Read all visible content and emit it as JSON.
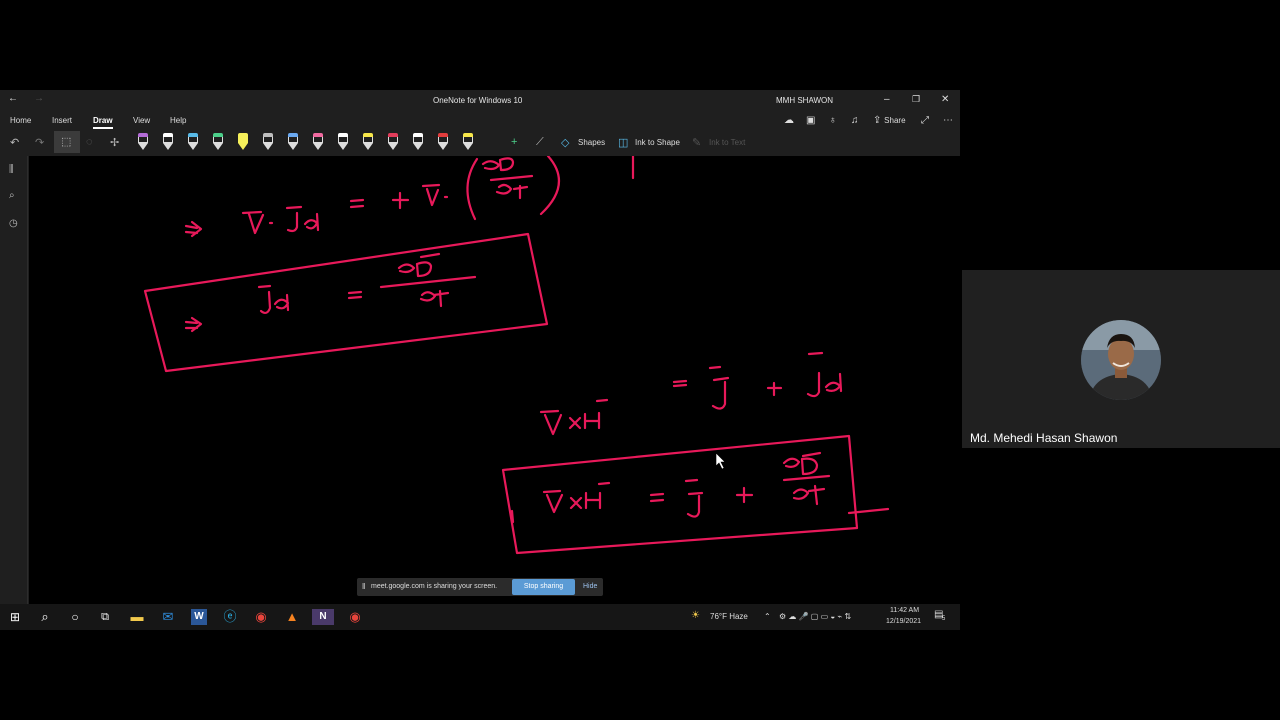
{
  "window": {
    "title": "OneNote for Windows 10",
    "user": "MMH SHAWON",
    "share_label": "Share"
  },
  "menu": {
    "home": "Home",
    "insert": "Insert",
    "draw": "Draw",
    "view": "View",
    "help": "Help"
  },
  "toolbar": {
    "shapes": "Shapes",
    "ink_to_shape": "Ink to Shape",
    "ink_to_text": "Ink to Text",
    "pens": [
      {
        "color": "#b36bd6",
        "type": "pen"
      },
      {
        "color": "#ffffff",
        "type": "pen"
      },
      {
        "color": "#58b9e6",
        "type": "pen"
      },
      {
        "color": "#4ccf8a",
        "type": "pen"
      },
      {
        "color": "#f6f05a",
        "type": "highlighter"
      },
      {
        "color": "#bdbdbd",
        "type": "pen"
      },
      {
        "color": "#6aa8f0",
        "type": "pen"
      },
      {
        "color": "#f06aa0",
        "type": "pen"
      },
      {
        "color": "#ffffff",
        "type": "pen"
      },
      {
        "color": "#f6e64a",
        "type": "pen"
      },
      {
        "color": "#e23c5a",
        "type": "pen"
      },
      {
        "color": "#ffffff",
        "type": "pen"
      },
      {
        "color": "#e23c3c",
        "type": "pen"
      },
      {
        "color": "#f6e64a",
        "type": "pen"
      }
    ]
  },
  "ink_color": "#e8195a",
  "share_notice": {
    "text": "meet.google.com is sharing your screen.",
    "stop": "Stop sharing",
    "hide": "Hide"
  },
  "taskbar": {
    "weather": "76°F  Haze",
    "time": "11:42 AM",
    "date": "12/19/2021",
    "notifications": "5"
  },
  "participant": {
    "name": "Md. Mehedi Hasan Shawon"
  }
}
